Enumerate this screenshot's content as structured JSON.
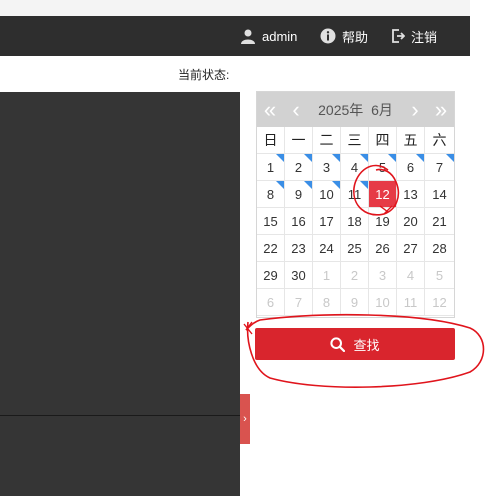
{
  "header": {
    "user_label": "admin",
    "help_label": "帮助",
    "logout_label": "注销"
  },
  "status": {
    "label": "当前状态:"
  },
  "calendar": {
    "year_month": "2025年  6月",
    "weekdays": [
      "日",
      "一",
      "二",
      "三",
      "四",
      "五",
      "六"
    ],
    "weeks": [
      [
        "1",
        "2",
        "3",
        "4",
        "5",
        "6",
        "7"
      ],
      [
        "8",
        "9",
        "10",
        "11",
        "12",
        "13",
        "14"
      ],
      [
        "15",
        "16",
        "17",
        "18",
        "19",
        "20",
        "21"
      ],
      [
        "22",
        "23",
        "24",
        "25",
        "26",
        "27",
        "28"
      ],
      [
        "29",
        "30",
        "1",
        "2",
        "3",
        "4",
        "5"
      ],
      [
        "6",
        "7",
        "8",
        "9",
        "10",
        "11",
        "12"
      ]
    ],
    "selected": "12"
  },
  "search_button": {
    "label": "查找"
  },
  "colors": {
    "header_bg": "#2e2e2e",
    "accent_red": "#d9252d",
    "selected_day": "#e63a46",
    "record_marker": "#3a8ee6"
  }
}
